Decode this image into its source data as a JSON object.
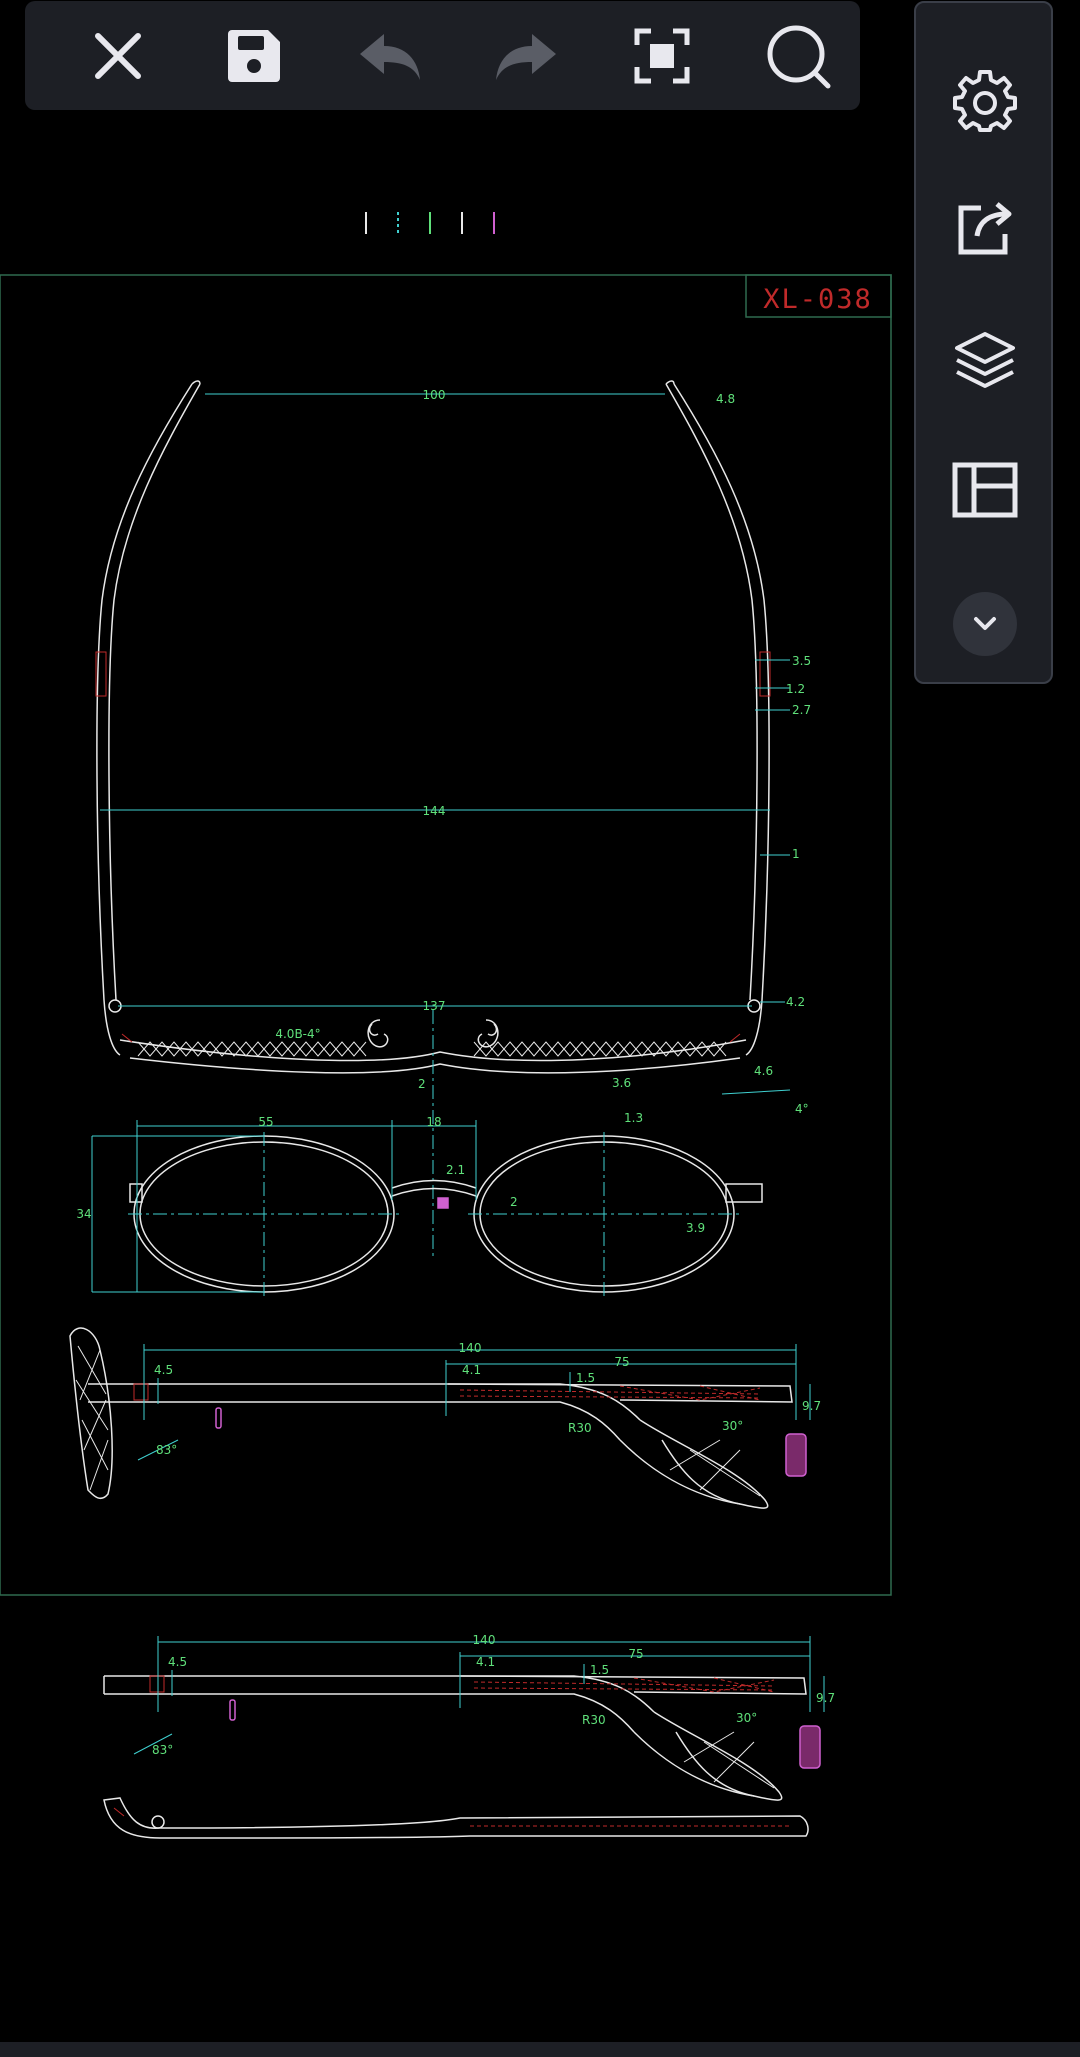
{
  "drawing": {
    "title_block": "XL-038",
    "top_view": {
      "dims": [
        "100",
        "4.8",
        "3.5",
        "1.2",
        "2.7",
        "144",
        "1",
        "137",
        "4.2",
        "4.0B-4°",
        "3.6",
        "4.6",
        "4°",
        "2"
      ]
    },
    "front_view": {
      "dims": [
        "55",
        "18",
        "1.3",
        "34",
        "2.1",
        "2",
        "3.9"
      ]
    },
    "side_view_1": {
      "dims": [
        "140",
        "75",
        "4.5",
        "4.1",
        "1.5",
        "9.7",
        "R30",
        "30°",
        "83°"
      ]
    },
    "side_view_2": {
      "dims": [
        "140",
        "75",
        "4.5",
        "4.1",
        "1.5",
        "9.7",
        "R30",
        "30°",
        "83°"
      ]
    }
  },
  "colors": {
    "toolbar_bg": "#1d1f25",
    "line_white": "#e8e8e8",
    "dim_cyan": "#3fd0d0",
    "text_green": "#5fe07a",
    "accent_red": "#c02a2a",
    "accent_magenta": "#d060d0",
    "frame_green": "#2f6b4f"
  },
  "icons": {
    "toolbar": [
      "close-icon",
      "save-icon",
      "undo-icon",
      "redo-icon",
      "fit-screen-icon",
      "search-icon"
    ],
    "side": [
      "settings-gear-icon",
      "export-share-icon",
      "layers-icon",
      "layout-panel-icon",
      "chevron-down-icon"
    ]
  }
}
